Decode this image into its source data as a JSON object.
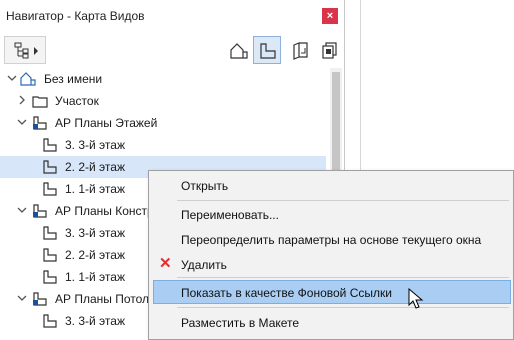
{
  "window": {
    "title": "Навигатор - Карта Видов",
    "close_glyph": "×"
  },
  "toolbar": {
    "buttons": [
      {
        "icon": "project-map-icon"
      },
      {
        "icon": "view-map-icon",
        "selected": true
      },
      {
        "icon": "layout-book-icon"
      },
      {
        "icon": "publisher-sets-icon"
      }
    ],
    "dropdown_icon": "tree-dropdown-icon"
  },
  "tree": {
    "rows": [
      {
        "label": "Без имени"
      },
      {
        "label": "Участок"
      },
      {
        "label": "АР Планы Этажей"
      },
      {
        "label": "3. 3-й этаж"
      },
      {
        "label": "2. 2-й этаж",
        "highlighted": true
      },
      {
        "label": "1. 1-й этаж"
      },
      {
        "label": "АР Планы Констру"
      },
      {
        "label": "3. 3-й этаж"
      },
      {
        "label": "2. 2-й этаж"
      },
      {
        "label": "1. 1-й этаж"
      },
      {
        "label": "АР Планы Потолк"
      },
      {
        "label": "3. 3-й этаж"
      }
    ]
  },
  "context_menu": {
    "items": [
      {
        "label": "Открыть"
      },
      {
        "label": "Переименовать..."
      },
      {
        "label": "Переопределить параметры на основе текущего окна"
      },
      {
        "label": "Удалить",
        "icon": "delete-x-icon"
      },
      {
        "label": "Показать в качестве Фоновой Ссылки",
        "highlighted": true
      },
      {
        "label": "Разместить в Макете"
      }
    ],
    "delete_glyph": "✕"
  },
  "colors": {
    "selection": "#d7e6f8",
    "menu_highlight": "#a9cdf3",
    "close_button": "#d8354b",
    "delete_icon": "#e03030"
  }
}
